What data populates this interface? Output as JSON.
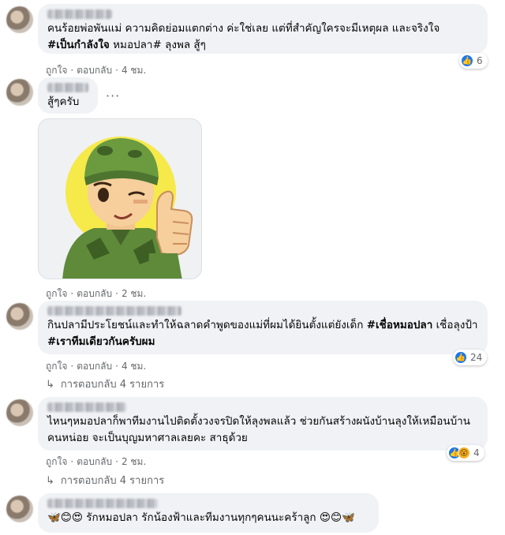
{
  "comments": [
    {
      "text_plain": "คนร้อยพ่อพันแม่ ความคิดย่อมแตกต่าง ค่ะใช่เลย แต่ที่สำคัญใครจะมีเหตุผล และจริงใจ",
      "text_bold": "#เป็นกำลังใจ",
      "text_tail": " หมอปลา# ลุงพล สู้ๆ",
      "like": "ถูกใจ",
      "reply": "ตอบกลับ",
      "time": "4 ชม.",
      "reaction_count": "6"
    },
    {
      "text_plain": "สู้ๆครับ",
      "like": "ถูกใจ",
      "reply": "ตอบกลับ",
      "time": "2 ชม.",
      "more": "···"
    },
    {
      "text_plain": "กินปลามีประโยชน์และทำให้ฉลาดคำพูดของแม่ที่ผมได้ยินตั้งแต่ยังเด็ก ",
      "text_bold": "#เชื่อหมอปลา",
      "text_tail": " เชื่อลุงป้า ",
      "text_bold2": "#เราทีมเดียวกันครับผม",
      "like": "ถูกใจ",
      "reply": "ตอบกลับ",
      "time": "4 ชม.",
      "reaction_count": "24",
      "replies": "การตอบกลับ 4 รายการ"
    },
    {
      "text_plain": "ไหนๆหมอปลาก็พาทีมงานไปติดตั้งวงจรปิดให้ลุงพลแล้ว ช่วยกันสร้างผนังบ้านลุงให้เหมือนบ้านคนหน่อย จะเป็นบุญมหาศาลเลยคะ สาธุด้วย",
      "like": "ถูกใจ",
      "reply": "ตอบกลับ",
      "time": "2 ชม.",
      "reaction_count": "4",
      "replies": "การตอบกลับ 4 รายการ"
    },
    {
      "emoji_lead": "🦋😊😍",
      "text_plain": " รักหมอปลา รักน้องฟ้าและทีมงานทุกๆคนนะคร้าลูก ",
      "emoji_tail": "😍😊🦋"
    }
  ],
  "colors": {
    "bubble": "#f0f2f5",
    "meta": "#65676b",
    "like_blue": "#1877f2"
  },
  "icons": [
    "like-icon",
    "wow-icon",
    "reply-arrow-icon",
    "soldier-thumbs-up-sticker"
  ]
}
